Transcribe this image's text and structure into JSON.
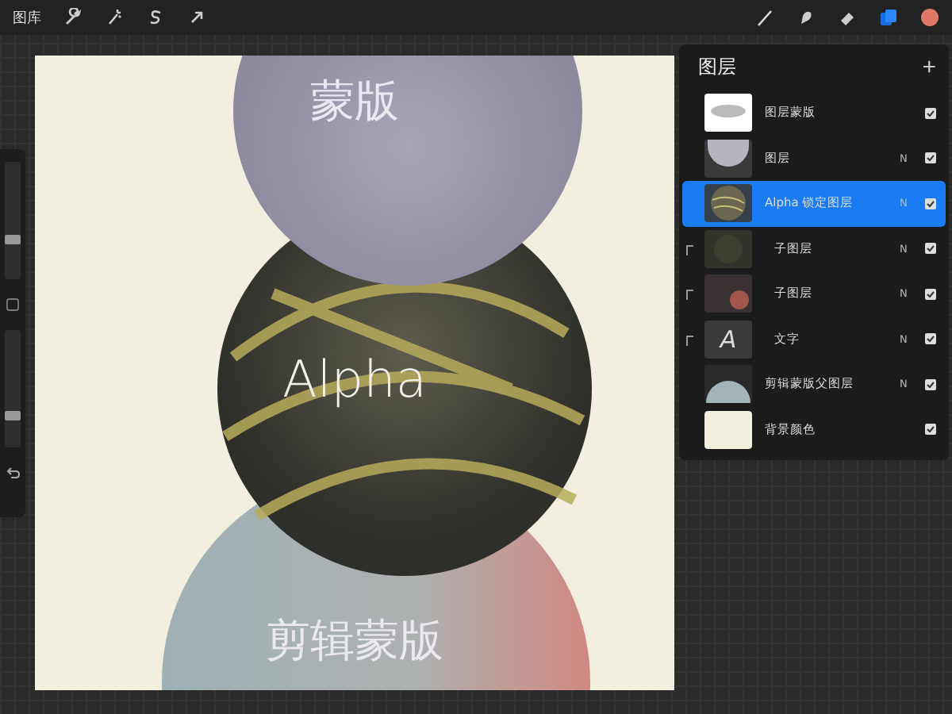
{
  "top_bar": {
    "gallery": "图库"
  },
  "sidebar": {
    "sliders": [
      {
        "level": 0.33
      },
      {
        "level": 0.25
      }
    ]
  },
  "canvas": {
    "labels": [
      {
        "text": "蒙版",
        "kind": "top"
      },
      {
        "text": "Alpha",
        "kind": "middle"
      },
      {
        "text": "剪辑蒙版",
        "kind": "bottom"
      }
    ]
  },
  "layers": {
    "title": "图层",
    "add": "+",
    "items": [
      {
        "name": "图层蒙版",
        "kind": "mask",
        "clipped": false,
        "selected": false,
        "checked": true
      },
      {
        "name": "图层",
        "kind": "gray-half",
        "clipped": false,
        "mode": "N",
        "selected": false,
        "checked": true
      },
      {
        "name": "Alpha 锁定图层",
        "kind": "sphere",
        "clipped": false,
        "mode": "N",
        "selected": true,
        "checked": true
      },
      {
        "name": "子图层",
        "kind": "dark",
        "clipped": true,
        "mode": "N",
        "selected": false,
        "checked": true
      },
      {
        "name": "子图层",
        "kind": "red",
        "clipped": true,
        "mode": "N",
        "selected": false,
        "checked": true
      },
      {
        "name": "文字",
        "kind": "text",
        "thumb_text": "A",
        "clipped": true,
        "mode": "N",
        "selected": false,
        "checked": true
      },
      {
        "name": "剪辑蒙版父图层",
        "kind": "blue-half",
        "clipped": false,
        "mode": "N",
        "selected": false,
        "checked": true
      },
      {
        "name": "背景颜色",
        "kind": "color",
        "clipped": false,
        "selected": false,
        "checked": true
      }
    ]
  }
}
